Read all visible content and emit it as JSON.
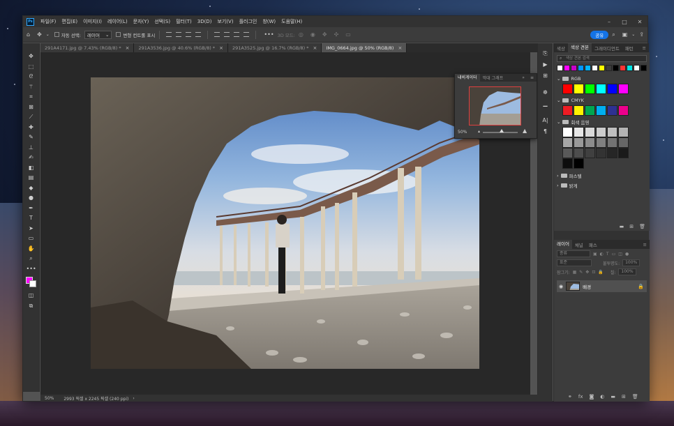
{
  "menu": {
    "items": [
      "파일(F)",
      "편집(E)",
      "이미지(I)",
      "레이어(L)",
      "문자(Y)",
      "선택(S)",
      "필터(T)",
      "3D(D)",
      "보기(V)",
      "플러그인",
      "창(W)",
      "도움말(H)"
    ]
  },
  "window_controls": {
    "minimize": "–",
    "maximize": "□",
    "close": "✕"
  },
  "options": {
    "auto_select_label": "자동 선택:",
    "auto_select_value": "레이어",
    "transform_controls_label": "변형 컨트롤 표시",
    "mode_3d_label": "3D 모드:",
    "share_label": "공유"
  },
  "tabs": [
    {
      "label": "291A4171.jpg @ 7.43% (RGB/8) *",
      "close": "×"
    },
    {
      "label": "291A3536.jpg @ 40.6% (RGB/8) *",
      "close": "×"
    },
    {
      "label": "291A3525.jpg @ 16.7% (RGB/8) *",
      "close": "×"
    },
    {
      "label": "IMG_0664.jpg @ 50% (RGB/8)",
      "close": "×"
    }
  ],
  "status": {
    "zoom": "50%",
    "doc_size": "2993 픽셀 x 2245 픽셀 (240 ppi)",
    "arrow": "›"
  },
  "navigator": {
    "tab_navigator": "내비게이터",
    "tab_histogram": "막대 그래프",
    "zoom": "50%"
  },
  "swatches": {
    "tabs": [
      "색상",
      "색상 견본",
      "그레이디언트",
      "패턴"
    ],
    "search_placeholder": "색상 견본 검색",
    "recent": [
      "#ffffff",
      "#ff00ff",
      "#c800c8",
      "#0096ff",
      "#00b4ff",
      "#ffffff",
      "#ffff00",
      "#3c3c3c",
      "#000000",
      "#ff3333",
      "#00e5e5",
      "#ffffff",
      "#000000"
    ],
    "groups": [
      {
        "name": "RGB",
        "colors": [
          "#ff0000",
          "#ffff00",
          "#00ff00",
          "#00ffff",
          "#0000ff",
          "#ff00ff"
        ]
      },
      {
        "name": "CMYK",
        "colors": [
          "#ed1c24",
          "#fff200",
          "#00a651",
          "#00aeef",
          "#2e3192",
          "#ec008c"
        ]
      },
      {
        "name": "회색 음영",
        "colors": [
          "#ffffff",
          "#e6e6e6",
          "#d9d9d9",
          "#cccccc",
          "#bfbfbf",
          "#b3b3b3",
          "#a6a6a6",
          "#999999",
          "#8c8c8c",
          "#808080",
          "#737373",
          "#666666",
          "#595959",
          "#4d4d4d",
          "#404040",
          "#333333",
          "#262626",
          "#1a1a1a",
          "#0d0d0d",
          "#000000"
        ]
      },
      {
        "name": "파스텔"
      },
      {
        "name": "밝게"
      }
    ]
  },
  "layers": {
    "tabs": [
      "레이어",
      "채널",
      "패스"
    ],
    "search": "종류",
    "blend": "표준",
    "opacity_label": "불투명도:",
    "opacity_value": "100%",
    "lock_label": "잠그기:",
    "fill_label": "칠:",
    "fill_value": "100%",
    "items": [
      {
        "name": "배경",
        "visible": true,
        "locked": true
      }
    ]
  }
}
